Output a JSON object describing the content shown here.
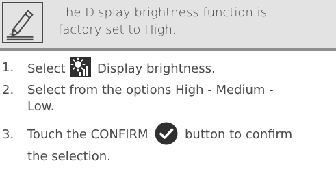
{
  "note": {
    "line1": "The Display brightness function is",
    "line2": "factory set to High.",
    "icon": "note-pencil-icon"
  },
  "steps": [
    {
      "number": "1.",
      "before_icon": "Select",
      "icon": "display-brightness-icon",
      "after_icon": "Display brightness."
    },
    {
      "number": "2.",
      "line1": "Select from the options High - Medium -",
      "line2": "Low."
    },
    {
      "number": "3.",
      "before_icon": "Touch the CONFIRM",
      "icon": "confirm-check-icon",
      "after_icon": "button to confirm",
      "line2": "the selection."
    }
  ],
  "colors": {
    "text": "#4a4a4a",
    "note_background": "#e3e3e3",
    "note_border": "#8f8f8f",
    "icon_dark": "#2f2f2f"
  }
}
